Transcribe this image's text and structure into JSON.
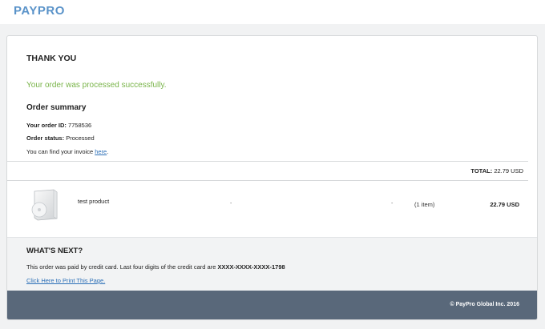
{
  "header": {
    "logo_text": "PAYPRO"
  },
  "order": {
    "title": "THANK YOU",
    "success_message": "Your order was processed successfully.",
    "summary_heading": "Order summary",
    "id_label": "Your order ID:",
    "id_value": "7758536",
    "status_label": "Order status:",
    "status_value": "Processed",
    "invoice_text": "You can find your invoice",
    "invoice_link": "here",
    "invoice_period": ".",
    "total_label": "TOTAL:",
    "total_value": "22.79 USD"
  },
  "items": [
    {
      "name": "test product",
      "col1": "-",
      "col2": "-",
      "quantity": "(1 item)",
      "price": "22.79 USD",
      "icon": "software-box-icon"
    }
  ],
  "whats_next": {
    "heading": "WHAT'S NEXT?",
    "text": "This order was paid by credit card. Last four digits of the credit card are",
    "card_mask": "XXXX-XXXX-XXXX-1798",
    "print_link": "Click Here to Print This Page."
  },
  "footer": {
    "copyright": "© PayPro Global Inc. 2016"
  },
  "colors": {
    "success": "#79b449",
    "link": "#2c6fb7",
    "footer_bg": "#59687a",
    "logo": "#5a93c9"
  }
}
